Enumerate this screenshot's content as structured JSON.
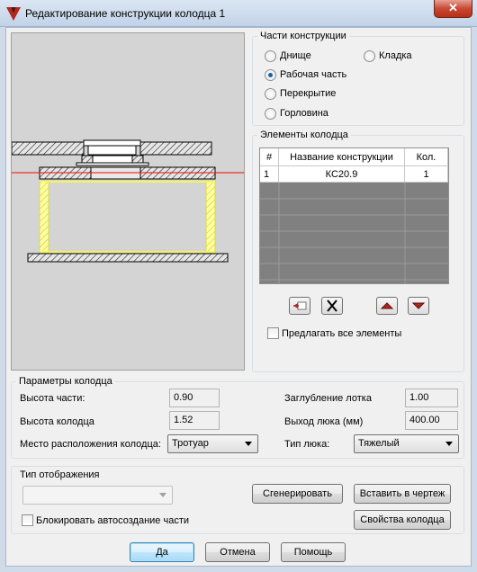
{
  "window": {
    "title": "Редактирование конструкции колодца 1",
    "close_label": "✕"
  },
  "parts": {
    "group_title": "Части конструкции",
    "options": [
      {
        "label": "Днище",
        "checked": false
      },
      {
        "label": "Кладка",
        "checked": false
      },
      {
        "label": "Рабочая часть",
        "checked": true
      },
      {
        "label": "Перекрытие",
        "checked": false
      },
      {
        "label": "Горловина",
        "checked": false
      }
    ]
  },
  "elements": {
    "group_title": "Элементы колодца",
    "columns": [
      "#",
      "Название конструкции",
      "Кол."
    ],
    "rows": [
      {
        "num": "1",
        "name": "КС20.9",
        "qty": "1"
      }
    ],
    "toolbar": [
      "insert-row-icon",
      "delete-icon",
      "move-up-icon",
      "move-down-icon"
    ],
    "suggest_all_label": "Предлагать все элементы",
    "suggest_all_checked": false
  },
  "params": {
    "group_title": "Параметры колодца",
    "part_height_label": "Высота части:",
    "part_height": "0.90",
    "well_height_label": "Высота колодца",
    "well_height": "1.52",
    "tray_depth_label": "Заглубление лотка",
    "tray_depth": "1.00",
    "hatch_exit_label": "Выход люка (мм)",
    "hatch_exit": "400.00",
    "location_label": "Место расположения колодца:",
    "location_value": "Тротуар",
    "hatch_type_label": "Тип люка:",
    "hatch_type_value": "Тяжелый"
  },
  "display": {
    "group_title": "Тип отображения",
    "display_value": "",
    "lock_autocreate_label": "Блокировать автосоздание части",
    "lock_autocreate_checked": false,
    "generate_label": "Сгенерировать",
    "insert_label": "Вставить в чертеж",
    "props_label": "Свойства колодца"
  },
  "footer": {
    "ok_label": "Да",
    "cancel_label": "Отмена",
    "help_label": "Помощь"
  },
  "colors": {
    "highlight_part": "#ffff66",
    "level_line": "#ff0000",
    "hatch": "#222222"
  }
}
